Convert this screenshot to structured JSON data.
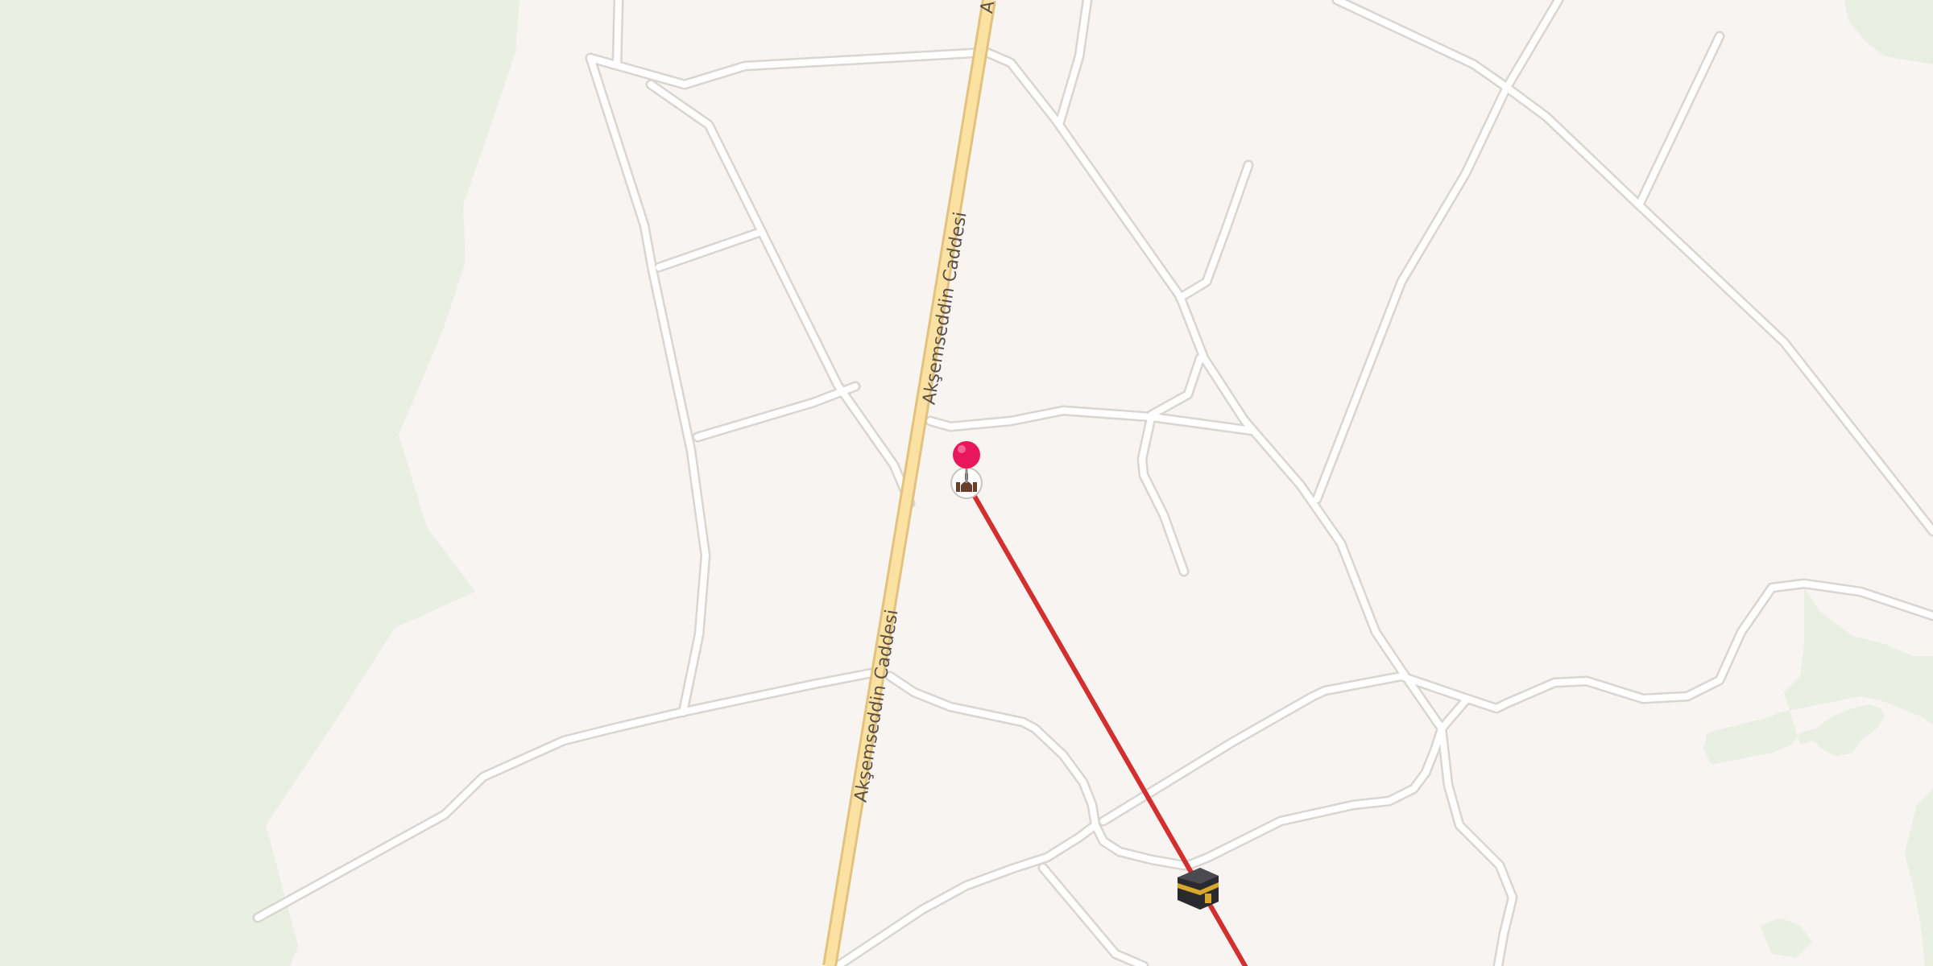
{
  "map": {
    "streets": [
      {
        "name": "Akşemseddin Caddesi"
      },
      {
        "name": "Akşemseddin Caddesi"
      },
      {
        "name": "A"
      }
    ],
    "markers": [
      {
        "kind": "location-pin",
        "color": "#e8175d"
      },
      {
        "kind": "mosque-poi"
      },
      {
        "kind": "kaaba-qibla"
      }
    ],
    "qibla_line_color": "#d32f2f",
    "colors": {
      "land": "#f7f4f1",
      "park": "#e9efe3",
      "road": "#ffffff",
      "road_casing": "#d9d5d0",
      "main_road": "#fbe2a3",
      "main_road_casing": "#e2c27c"
    }
  }
}
